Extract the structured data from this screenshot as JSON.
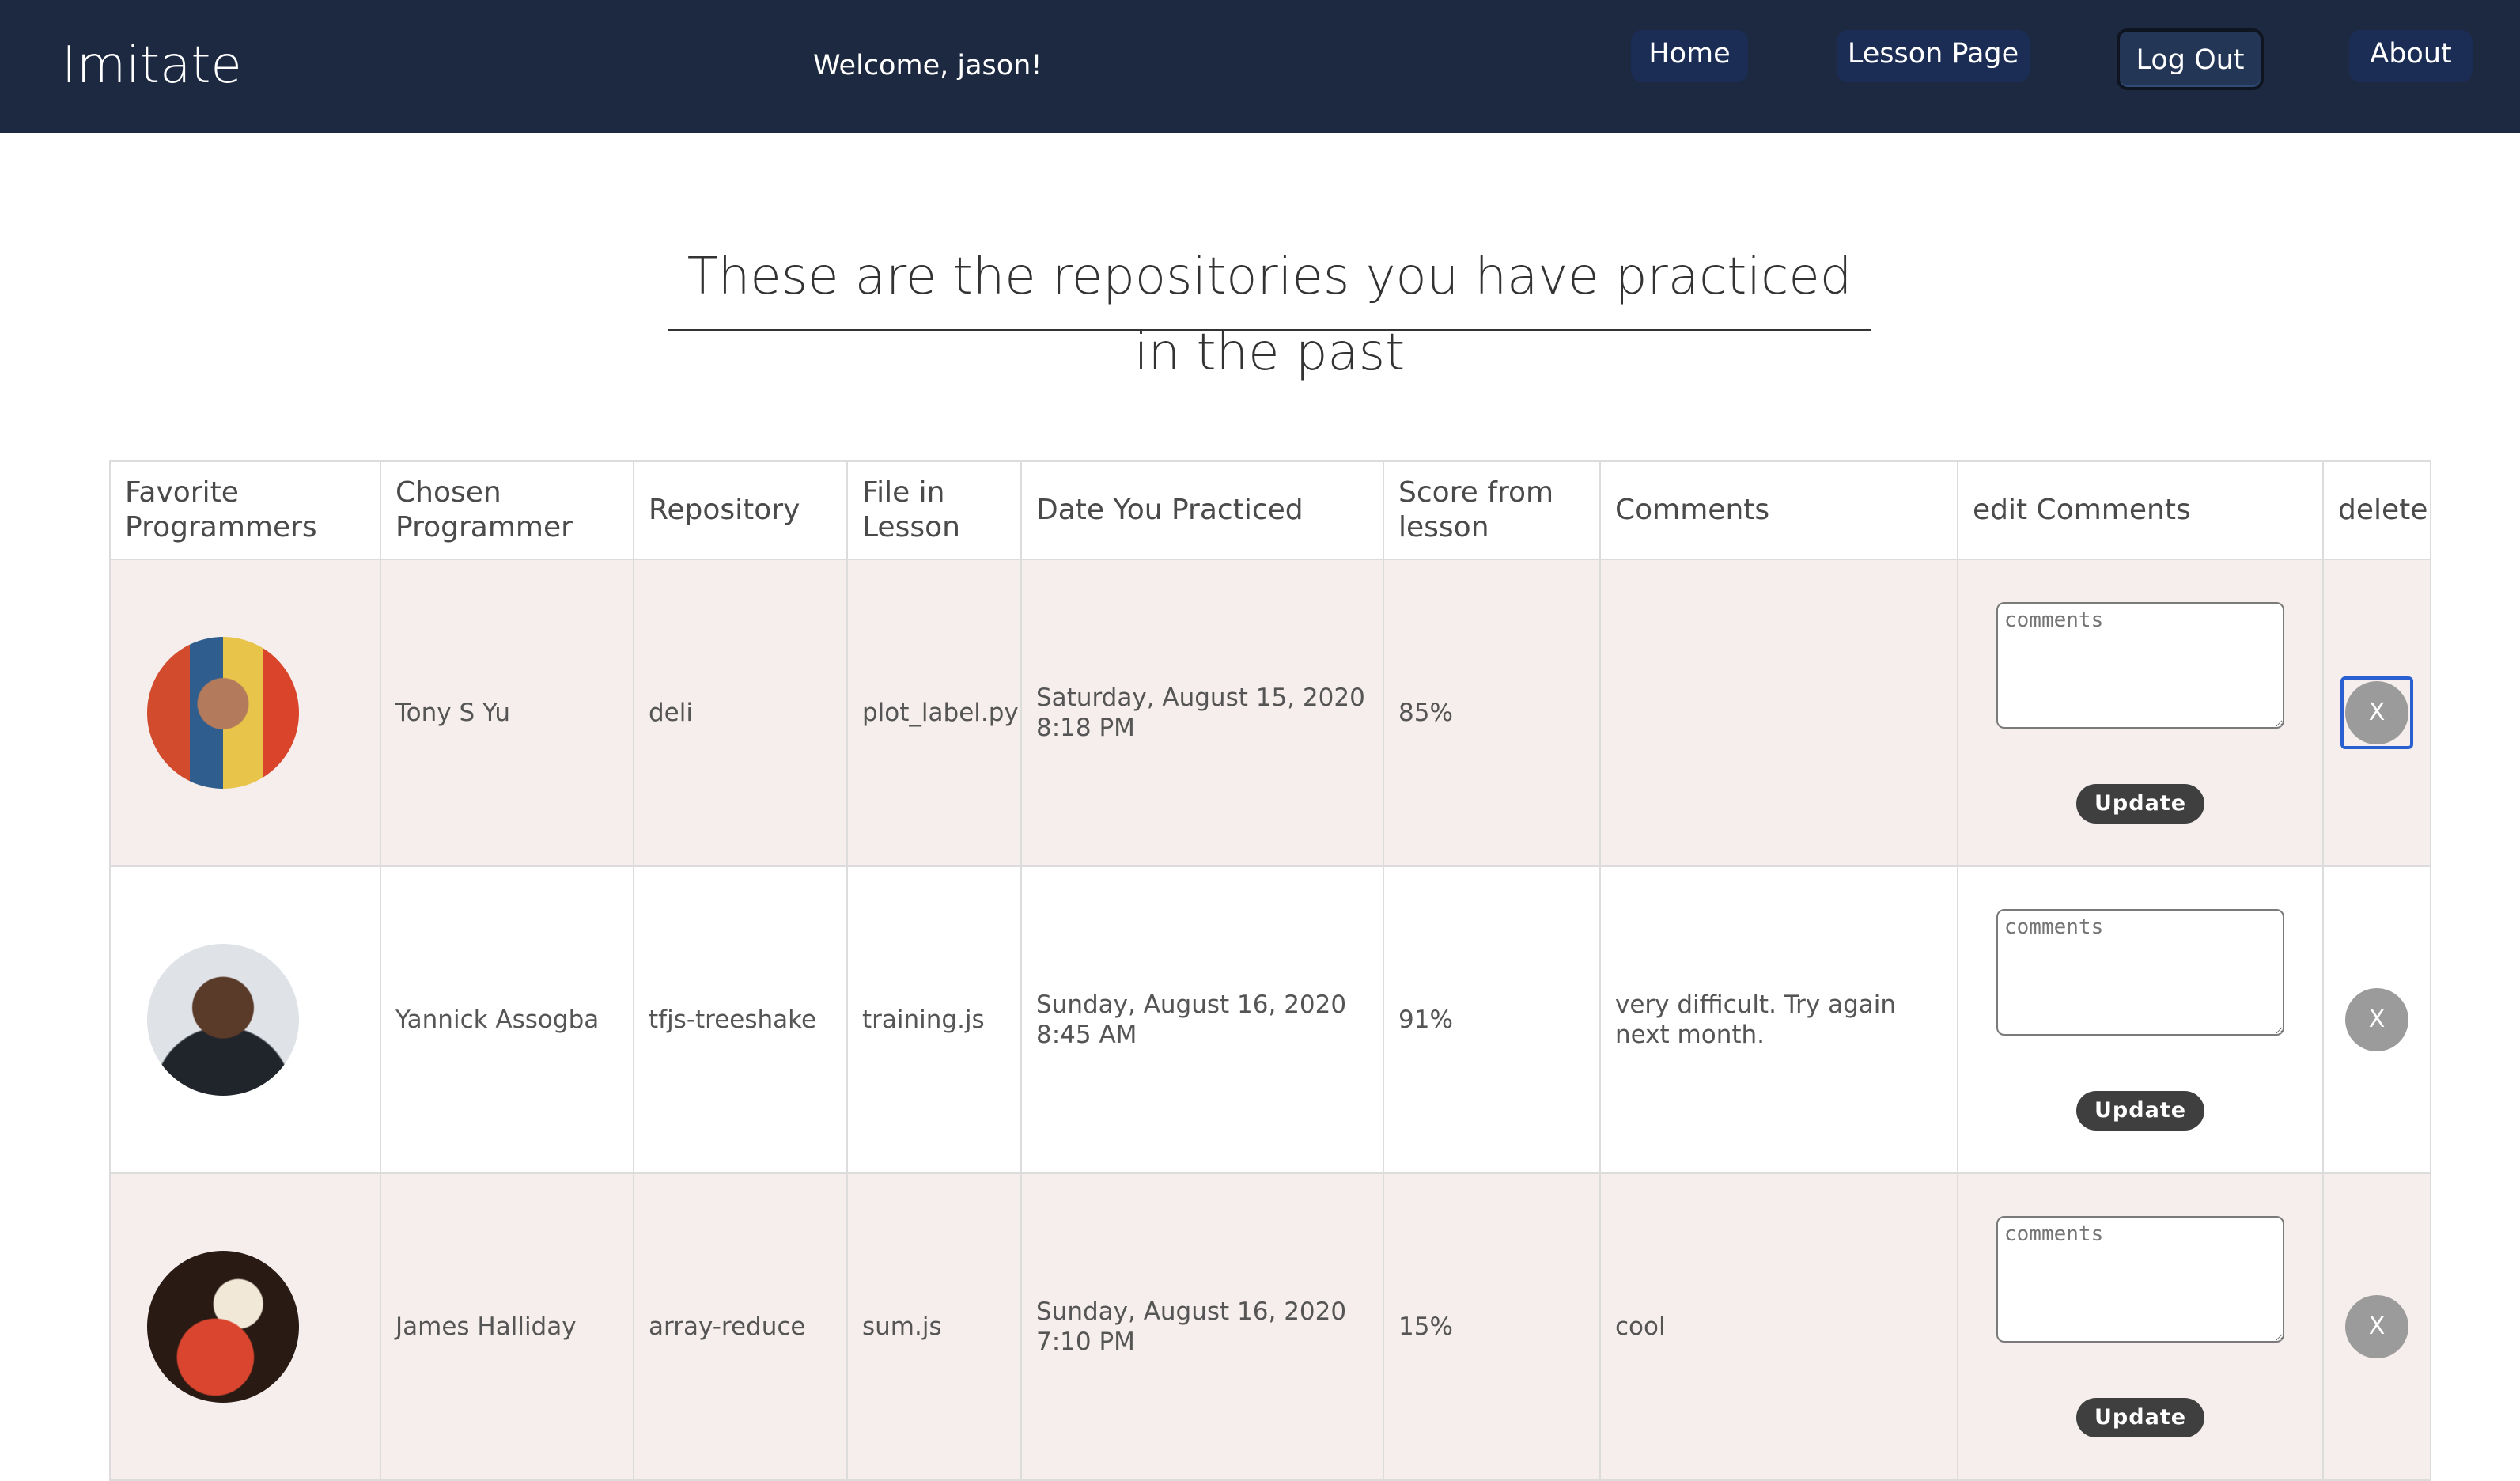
{
  "navbar": {
    "brand": "Imitate",
    "welcome": "Welcome, jason!",
    "home_label": "Home",
    "lesson_label": "Lesson Page",
    "logout_label": "Log Out",
    "about_label": "About"
  },
  "page": {
    "heading": "These are the repositories you have practiced in the past"
  },
  "table": {
    "headers": [
      "Favorite Programmers",
      "Chosen Programmer",
      "Repository",
      "File in Lesson",
      "Date You Practiced",
      "Score from lesson",
      "Comments",
      "edit Comments",
      "delete"
    ],
    "comments_placeholder": "comments",
    "update_label": "Update",
    "delete_label": "X",
    "rows": [
      {
        "programmer": "Tony S Yu",
        "repository": "deli",
        "file": "plot_label.py",
        "date": "Saturday, August 15, 2020 8:18 PM",
        "score": "85%",
        "comments": ""
      },
      {
        "programmer": "Yannick Assogba",
        "repository": "tfjs-treeshake",
        "file": "training.js",
        "date": "Sunday, August 16, 2020 8:45 AM",
        "score": "91%",
        "comments": "very difficult. Try again next month."
      },
      {
        "programmer": "James Halliday",
        "repository": "array-reduce",
        "file": "sum.js",
        "date": "Sunday, August 16, 2020 7:10 PM",
        "score": "15%",
        "comments": "cool"
      }
    ]
  }
}
